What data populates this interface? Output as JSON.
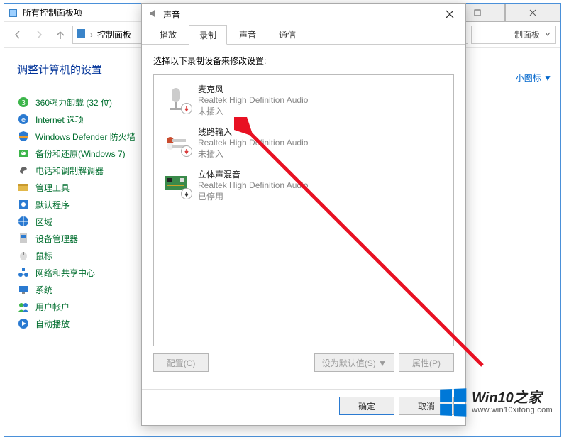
{
  "cp": {
    "title": "所有控制面板项",
    "breadcrumb": "控制面板",
    "breadcrumb_tail": "制面板",
    "heading": "调整计算机的设置",
    "view_by": "小图标 ▼",
    "items": [
      "360强力卸载 (32 位)",
      "Internet 选项",
      "Windows Defender 防火墙",
      "备份和还原(Windows 7)",
      "电话和调制解调器",
      "管理工具",
      "默认程序",
      "区域",
      "设备管理器",
      "鼠标",
      "网络和共享中心",
      "系统",
      "用户帐户",
      "自动播放"
    ]
  },
  "sound": {
    "title": "声音",
    "tabs": [
      "播放",
      "录制",
      "声音",
      "通信"
    ],
    "active_tab": 1,
    "instruction": "选择以下录制设备来修改设置:",
    "devices": [
      {
        "name": "麦克风",
        "sub": "Realtek High Definition Audio",
        "status": "未插入",
        "badge": "down"
      },
      {
        "name": "线路输入",
        "sub": "Realtek High Definition Audio",
        "status": "未插入",
        "badge": "down"
      },
      {
        "name": "立体声混音",
        "sub": "Realtek High Definition Audio",
        "status": "已停用",
        "badge": "down-dark"
      }
    ],
    "buttons": {
      "configure": "配置(C)",
      "set_default": "设为默认值(S) ▼",
      "properties": "属性(P)",
      "ok": "确定",
      "cancel": "取消"
    }
  },
  "watermark": {
    "main": "Win10之家",
    "sub": "www.win10xitong.com"
  }
}
